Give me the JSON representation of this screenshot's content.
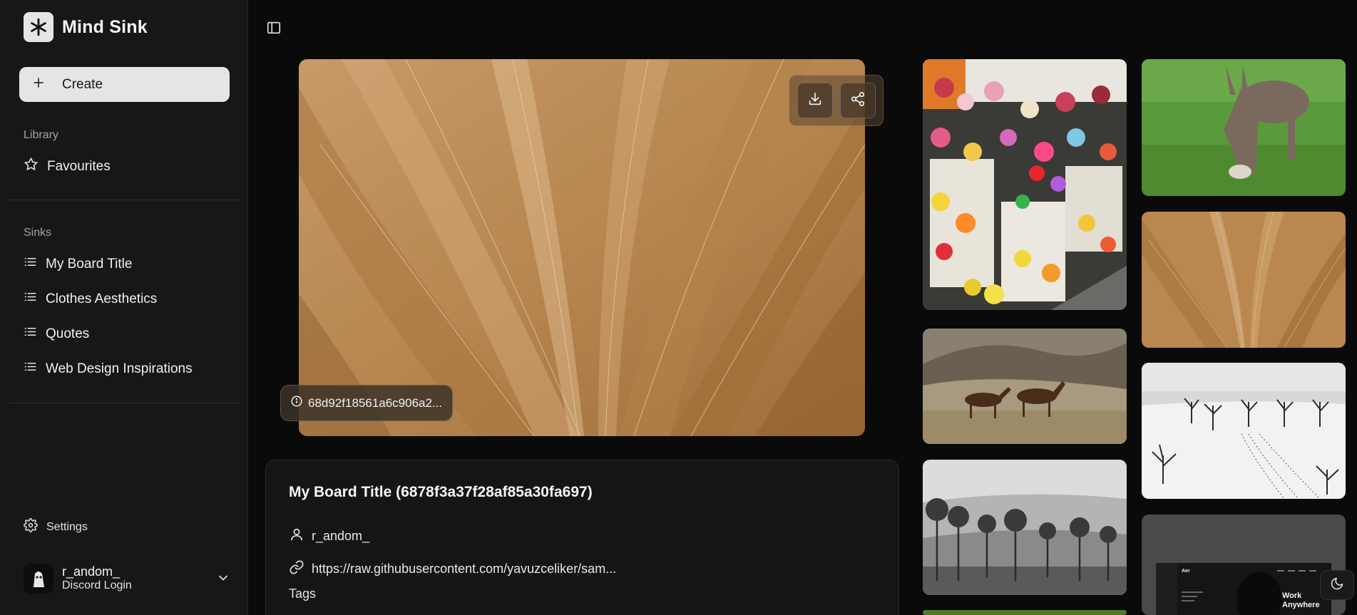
{
  "app": {
    "name": "Mind Sink"
  },
  "sidebar": {
    "create_label": "Create",
    "library_label": "Library",
    "favourites_label": "Favourites",
    "sinks_label": "Sinks",
    "sinks": [
      "My Board Title",
      "Clothes Aesthetics",
      "Quotes",
      "Web Design Inspirations"
    ],
    "settings_label": "Settings",
    "user": {
      "name": "r_andom_",
      "subtitle": "Discord Login"
    }
  },
  "main": {
    "image_id": "68d92f18561a6c906a2...",
    "details": {
      "title": "My Board Title (6878f3a37f28af85a30fa697)",
      "author": "r_andom_",
      "source_url": "https://raw.githubusercontent.com/yavuzceliker/sam...",
      "tags_label": "Tags"
    }
  },
  "gallery": {
    "mock_site": {
      "logo": "Aer",
      "headline_1": "Work",
      "headline_2": "Anywhere"
    }
  },
  "colors": {
    "sidebar_bg": "#171717",
    "page_bg": "#0a0a0a",
    "create_bg": "#e5e5e5",
    "accent_brown": "#b07a45"
  }
}
